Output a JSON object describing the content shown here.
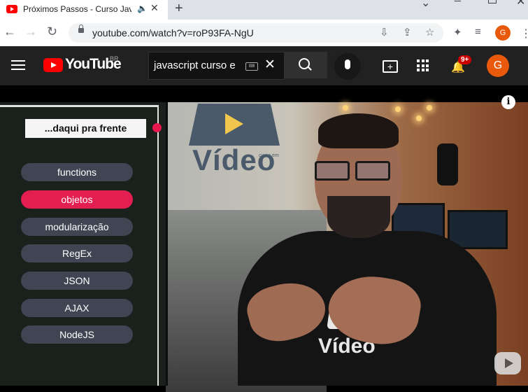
{
  "browser": {
    "tab_title": "Próximos Passos - Curso Java",
    "url": "youtube.com/watch?v=roP93FA-NgU",
    "new_tab_label": "+",
    "profile_letter": "G",
    "audio_icon": "speaker-icon"
  },
  "youtube": {
    "logo_text": "YouTube",
    "country_code": "BR",
    "search_query": "javascript curso e",
    "notification_count": "9+",
    "avatar_letter": "G"
  },
  "video": {
    "overlay_title": "...daqui pra frente",
    "topics": [
      {
        "label": "functions",
        "active": false
      },
      {
        "label": "objetos",
        "active": true
      },
      {
        "label": "modularização",
        "active": false
      },
      {
        "label": "RegEx",
        "active": false
      },
      {
        "label": "JSON",
        "active": false
      },
      {
        "label": "AJAX",
        "active": false
      },
      {
        "label": "NodeJS",
        "active": false
      }
    ],
    "wall_logo_text": "Vídeo",
    "wall_logo_subtext": "curso em",
    "shirt_text": "Vídeo",
    "info_icon": "i"
  },
  "colors": {
    "youtube_red": "#ff0000",
    "active_pill": "#e21f50",
    "inactive_pill": "#3f4552",
    "header_bg": "#212121"
  }
}
